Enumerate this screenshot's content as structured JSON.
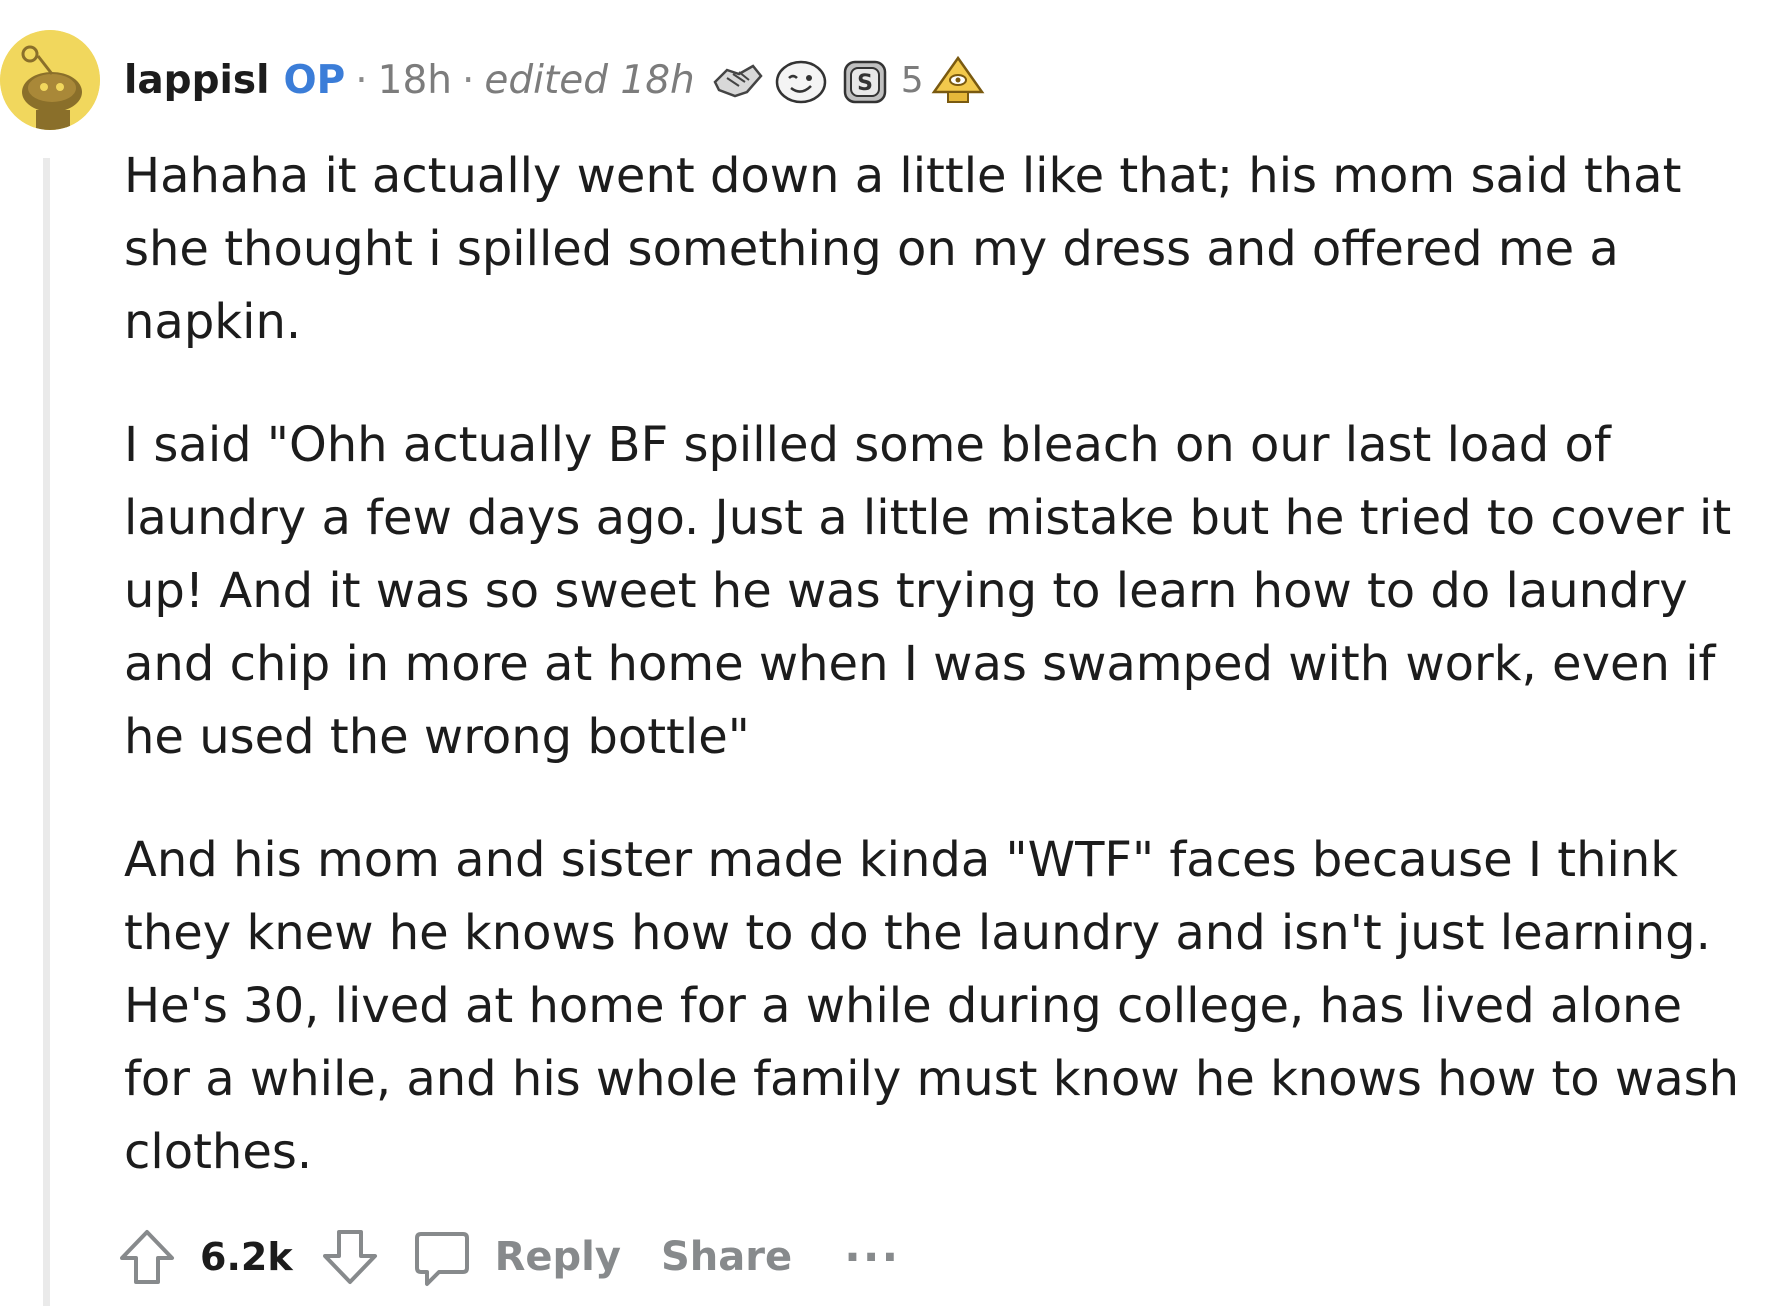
{
  "comment": {
    "author": "lappisl",
    "op_badge": "OP",
    "separator": "·",
    "time": "18h",
    "edited": "edited 18h",
    "awards": [
      {
        "icon": "handshake-award-icon"
      },
      {
        "icon": "wink-face-award-icon"
      },
      {
        "icon": "silver-award-icon",
        "count": "5"
      },
      {
        "icon": "all-seeing-pyramid-award-icon"
      }
    ],
    "paragraphs": [
      "Hahaha it actually went down a little like that; his mom said that she thought i spilled something on my dress and offered me a napkin.",
      "I said \"Ohh actually BF spilled some bleach on our last load of laundry a few days ago. Just a little mistake but he tried to cover it up! And it was so sweet he was trying to learn how to do laundry and chip in more at home when I was swamped with work, even if he used the wrong bottle\"",
      "And his mom and sister made kinda \"WTF\" faces because I think they knew he knows how to do the laundry and isn't just learning. He's 30, lived at home for a while during college, has lived alone for a while, and his whole family must know he knows how to wash clothes."
    ]
  },
  "actions": {
    "score": "6.2k",
    "reply_label": "Reply",
    "share_label": "Share",
    "more_label": "···"
  },
  "colors": {
    "op_blue": "#3b7dd8",
    "avatar_yellow": "#f1d75d",
    "muted_gray": "#878a8c"
  }
}
